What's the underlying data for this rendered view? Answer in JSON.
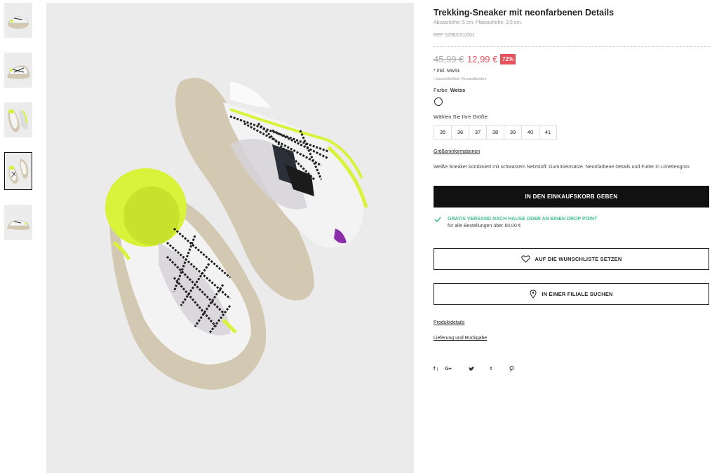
{
  "thumbnails": [
    {
      "name": "thumbnail-1",
      "selected": false
    },
    {
      "name": "thumbnail-2",
      "selected": false
    },
    {
      "name": "thumbnail-3",
      "selected": false
    },
    {
      "name": "thumbnail-4",
      "selected": true
    },
    {
      "name": "thumbnail-5",
      "selected": false
    }
  ],
  "product": {
    "title": "Trekking-Sneaker mit neonfarbenen Details",
    "subtitle": "Absatzhöhe: 5 cm. Plateauhöhe: 3,5 cm.",
    "ref": "REF 5296/031/001",
    "old_price": "45,99 €",
    "new_price": "12,99 €",
    "discount": "72%",
    "tax_note": "* inkl. MwSt.",
    "shipping_note": "/ ausschließlich Versandkosten",
    "color_label": "Farbe:",
    "color_value": "Weiss",
    "size_label": "Wählen Sie Ihre Größe:",
    "sizes": [
      "35",
      "36",
      "37",
      "38",
      "39",
      "40",
      "41"
    ],
    "size_info_link": "Größeninformationen",
    "description": "Weiße Sneaker kombiniert mit schwarzem Netzstoff. Gummieinsätze. Neonfarbene Details und Futter in Limettengrün."
  },
  "actions": {
    "add_to_cart": "IN DEN EINKAUFSKORB GEBEN",
    "free_shipping_title": "GRATIS VERSAND NACH HAUSE ODER AN EINEN DROP POINT",
    "free_shipping_sub": "für alle Bestellungen über 60,00 €",
    "wishlist": "AUF DIE WUNSCHLISTE SETZEN",
    "find_store": "IN EINER FILIALE SUCHEN"
  },
  "links": {
    "product_details": "Produktdetails",
    "delivery_returns": "Lieferung und Rückgabe"
  },
  "social": [
    "f",
    "G+",
    "t"
  ],
  "colors": {
    "price_red": "#e8505b",
    "free_shipping_green": "#3fbf8f",
    "neon": "#d9f23a",
    "sole": "#d3c9b2"
  }
}
